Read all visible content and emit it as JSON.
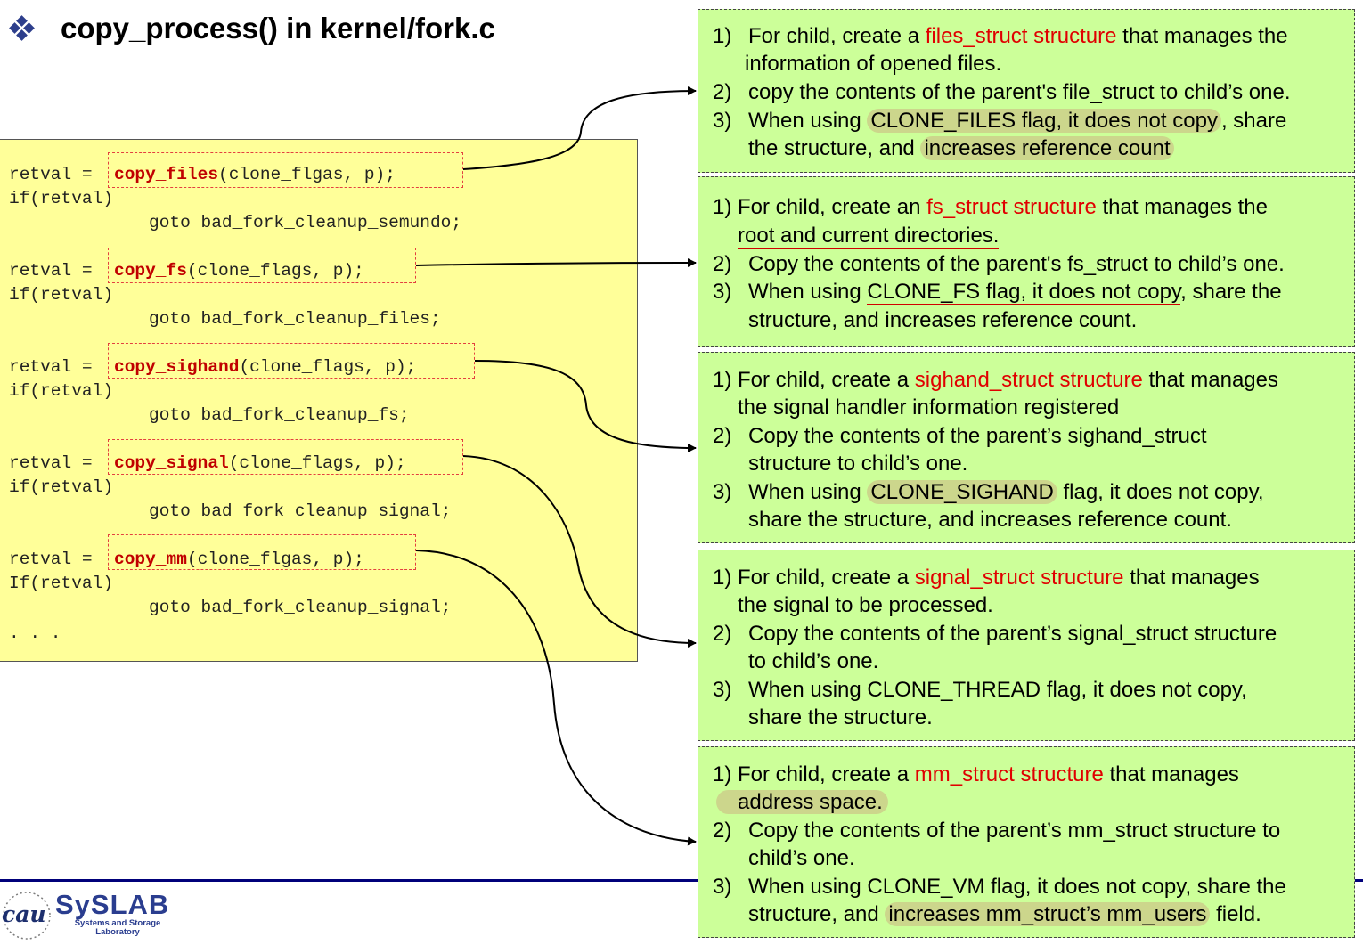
{
  "title": "copy_process() in kernel/fork.c",
  "code_blocks": [
    {
      "pre": "retval = ",
      "fn": "copy_files",
      "args": "(clone_flgas, p);",
      "cond": "if(retval)",
      "goto": "goto bad_fork_cleanup_semundo;"
    },
    {
      "pre": "retval = ",
      "fn": "copy_fs",
      "args": "(clone_flags, p);",
      "cond": "if(retval)",
      "goto": "goto bad_fork_cleanup_files;"
    },
    {
      "pre": "retval = ",
      "fn": "copy_sighand",
      "args": "(clone_flags, p);",
      "cond": "if(retval)",
      "goto": "goto bad_fork_cleanup_fs;"
    },
    {
      "pre": "retval = ",
      "fn": "copy_signal",
      "args": "(clone_flags, p);",
      "cond": "if(retval)",
      "goto": "goto bad_fork_cleanup_signal;"
    },
    {
      "pre": "retval = ",
      "fn": "copy_mm",
      "args": "(clone_flgas, p);",
      "cond": "If(retval)",
      "goto": "goto bad_fork_cleanup_signal;"
    }
  ],
  "ellipsis": ". . .",
  "panels": {
    "files": {
      "l1_num": "1)",
      "l1_a": "For child, create a ",
      "l1_red": "files_struct structure",
      "l1_b": " that manages the",
      "l2": "information of opened files.",
      "l3_num": "2)",
      "l3": "copy the contents of the parent's file_struct to child’s one.",
      "l4_num": "3)",
      "l4_a": "When using ",
      "l4_hl": "CLONE_FILES flag, it does not copy",
      "l4_b": ", share",
      "l5_a": "the structure, and ",
      "l5_hl": "increases reference count"
    },
    "fs": {
      "l1_a": "1) For child, create an ",
      "l1_red": "fs_struct structure",
      "l1_b": " that manages the",
      "l2": "root and current directories.",
      "l3_num": "2)",
      "l3": "Copy the contents of the parent's fs_struct to child’s one.",
      "l4_num": "3)",
      "l4_a": "When using ",
      "l4_ul": "CLONE_FS flag, it does not copy",
      "l4_b": ", share the",
      "l5": "structure, and increases reference count."
    },
    "sighand": {
      "l1_a": "1) For child, create a ",
      "l1_red": "sighand_struct structure",
      "l1_b": " that manages",
      "l2": "the signal handler information registered",
      "l3_num": "2)",
      "l3": "Copy the contents of the parent’s sighand_struct",
      "l4": "structure to child’s one.",
      "l5_num": "3)",
      "l5_a": "When using ",
      "l5_hl": "CLONE_SIGHAND",
      "l5_b": " flag, it does not copy,",
      "l6": "share the structure, and increases reference count."
    },
    "signal": {
      "l1_a": "1) For child, create a ",
      "l1_red": "signal_struct structure",
      "l1_b": " that manages",
      "l2": "the signal to be processed.",
      "l3_num": "2)",
      "l3": "Copy the contents of the parent’s signal_struct structure",
      "l4": "to child’s one.",
      "l5_num": "3)",
      "l5": "When using CLONE_THREAD flag, it does not copy,",
      "l6": "share the structure."
    },
    "mm": {
      "l1_a": "1) For child, create a ",
      "l1_red": "mm_struct structure",
      "l1_b": " that manages",
      "l2_hl": "address space.",
      "l3_num": "2)",
      "l3": "Copy the contents of the parent’s mm_struct structure to",
      "l4": "child’s one.",
      "l5_num": "3)",
      "l5": "When using CLONE_VM flag, it does not copy, share the",
      "l6_a": "structure, and ",
      "l6_hl": "increases mm_struct’s mm_users",
      "l6_b": " field."
    }
  },
  "logo": {
    "main": "SySLAB",
    "sub": "Systems and Storage Laboratory",
    "cau": "cau"
  },
  "colors": {
    "code_bg": "#ffff99",
    "panel_bg": "#ccff99",
    "accent_red": "#e00000",
    "rule": "#00007a"
  }
}
